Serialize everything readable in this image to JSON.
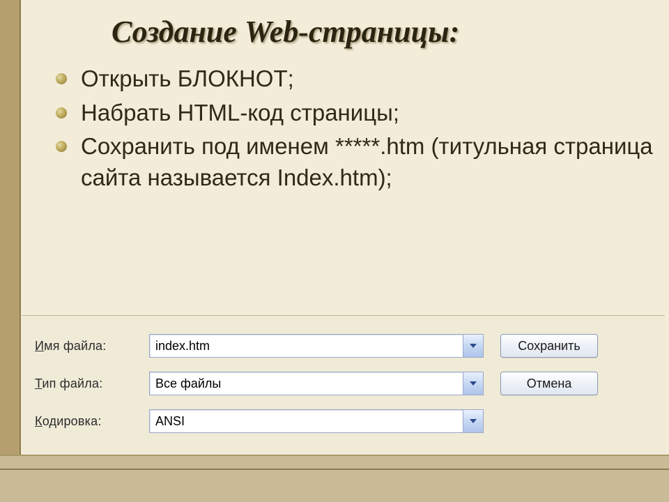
{
  "title": "Создание Web-страницы:",
  "bullets": [
    {
      "text": "Открыть  БЛОКНОТ;"
    },
    {
      "text": "Набрать HTML-код страницы;"
    },
    {
      "text": "Сохранить под именем *****.htm (титульная страница сайта называется Index.htm);"
    }
  ],
  "dialog": {
    "rows": {
      "filename": {
        "label_pre": "",
        "label_acc": "И",
        "label_post": "мя файла:",
        "value": "index.htm"
      },
      "filetype": {
        "label_pre": "",
        "label_acc": "Т",
        "label_post": "ип файла:",
        "value": "Все файлы"
      },
      "encoding": {
        "label_pre": "",
        "label_acc": "К",
        "label_post": "одировка:",
        "value": "ANSI"
      }
    },
    "buttons": {
      "save": "Сохранить",
      "cancel": "Отмена"
    }
  }
}
